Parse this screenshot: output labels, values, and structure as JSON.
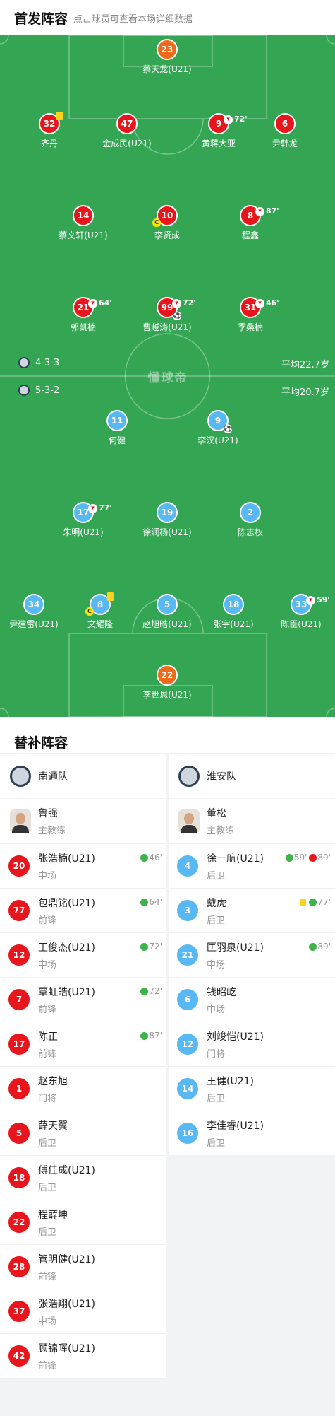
{
  "header": {
    "title": "首发阵容",
    "subtitle": "点击球员可查看本场详细数据"
  },
  "watermark": "懂球帝",
  "home": {
    "formation": "4-3-3",
    "avg_age": "平均22.7岁",
    "players": [
      {
        "num": "23",
        "name": "蔡天龙(U21)",
        "color": "gk"
      },
      {
        "num": "32",
        "name": "齐丹",
        "color": "red",
        "yellow": true
      },
      {
        "num": "47",
        "name": "金成民(U21)",
        "color": "red"
      },
      {
        "num": "9",
        "name": "黄蒋大亚",
        "color": "red",
        "sub": "72'"
      },
      {
        "num": "6",
        "name": "尹韩龙",
        "color": "red"
      },
      {
        "num": "14",
        "name": "蔡文轩(U21)",
        "color": "red"
      },
      {
        "num": "10",
        "name": "李贤成",
        "color": "red",
        "captain": "C"
      },
      {
        "num": "8",
        "name": "程鑫",
        "color": "red",
        "sub": "87'"
      },
      {
        "num": "21",
        "name": "郭凯楠",
        "color": "red",
        "sub": "64'"
      },
      {
        "num": "99",
        "name": "曹越涛(U21)",
        "color": "red",
        "sub": "72'",
        "goal": "⚽"
      },
      {
        "num": "31",
        "name": "季桑楠",
        "color": "red",
        "sub": "46'"
      }
    ]
  },
  "away": {
    "formation": "5-3-2",
    "avg_age": "平均20.7岁",
    "players": [
      {
        "num": "11",
        "name": "何健",
        "color": "blue"
      },
      {
        "num": "9",
        "name": "李汉(U21)",
        "color": "blue",
        "goal": "⚽"
      },
      {
        "num": "17",
        "name": "朱明(U21)",
        "color": "blue",
        "sub": "77'"
      },
      {
        "num": "19",
        "name": "徐润杨(U21)",
        "color": "blue"
      },
      {
        "num": "2",
        "name": "陈志权",
        "color": "blue"
      },
      {
        "num": "34",
        "name": "尹建雷(U21)",
        "color": "blue"
      },
      {
        "num": "8",
        "name": "文耀隆",
        "color": "blue",
        "yellow": true,
        "captain": "C"
      },
      {
        "num": "5",
        "name": "赵旭晧(U21)",
        "color": "blue"
      },
      {
        "num": "18",
        "name": "张宇(U21)",
        "color": "blue"
      },
      {
        "num": "33",
        "name": "陈臣(U21)",
        "color": "blue",
        "sub": "59'"
      },
      {
        "num": "22",
        "name": "李世恩(U21)",
        "color": "gk"
      }
    ]
  },
  "subs": {
    "title": "替补阵容",
    "left": {
      "team": "南通队",
      "coach": {
        "name": "鲁强",
        "role": "主教练"
      },
      "players": [
        {
          "num": "20",
          "name": "张浩楠(U21)",
          "pos": "中场",
          "ev": "46'"
        },
        {
          "num": "77",
          "name": "包鼎铭(U21)",
          "pos": "前锋",
          "ev": "64'"
        },
        {
          "num": "12",
          "name": "王俊杰(U21)",
          "pos": "中场",
          "ev": "72'"
        },
        {
          "num": "7",
          "name": "覃虹皓(U21)",
          "pos": "前锋",
          "ev": "72'"
        },
        {
          "num": "17",
          "name": "陈正",
          "pos": "前锋",
          "ev": "87'"
        },
        {
          "num": "1",
          "name": "赵东旭",
          "pos": "门将"
        },
        {
          "num": "5",
          "name": "薛天翼",
          "pos": "后卫"
        },
        {
          "num": "18",
          "name": "傅佳成(U21)",
          "pos": "后卫"
        },
        {
          "num": "22",
          "name": "程薛坤",
          "pos": "后卫"
        },
        {
          "num": "28",
          "name": "管明健(U21)",
          "pos": "前锋"
        },
        {
          "num": "37",
          "name": "张浩翔(U21)",
          "pos": "中场"
        },
        {
          "num": "42",
          "name": "顾锦晖(U21)",
          "pos": "前锋"
        }
      ]
    },
    "right": {
      "team": "淮安队",
      "coach": {
        "name": "董松",
        "role": "主教练"
      },
      "players": [
        {
          "num": "4",
          "name": "徐一航(U21)",
          "pos": "后卫",
          "ev": "59'",
          "ev2": "89'"
        },
        {
          "num": "3",
          "name": "戴虎",
          "pos": "后卫",
          "ev": "77'",
          "yellow": true
        },
        {
          "num": "21",
          "name": "匡羽泉(U21)",
          "pos": "中场",
          "ev": "89'"
        },
        {
          "num": "6",
          "name": "钱昭屹",
          "pos": "中场"
        },
        {
          "num": "12",
          "name": "刘竣恺(U21)",
          "pos": "门将"
        },
        {
          "num": "14",
          "name": "王健(U21)",
          "pos": "后卫"
        },
        {
          "num": "16",
          "name": "李佳睿(U21)",
          "pos": "后卫"
        }
      ]
    }
  }
}
